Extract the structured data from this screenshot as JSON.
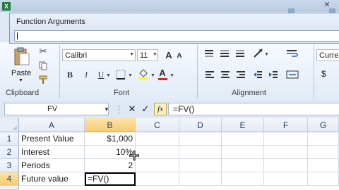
{
  "dialog": {
    "title": "Function Arguments",
    "input_value": ""
  },
  "ribbon": {
    "clipboard": {
      "label": "Clipboard",
      "paste_label": "Paste"
    },
    "font": {
      "label": "Font",
      "name": "Calibri",
      "size": "11",
      "bold": "B",
      "italic": "I",
      "underline": "U",
      "grow": "A",
      "shrink": "A"
    },
    "alignment": {
      "label": "Alignment"
    },
    "number": {
      "format": "Curren",
      "currency_symbol": "$"
    }
  },
  "formula_bar": {
    "name_box": "FV",
    "fx_label": "fx",
    "cancel": "✕",
    "enter": "✓",
    "content": "=FV()"
  },
  "grid": {
    "columns": [
      "A",
      "B",
      "C",
      "D",
      "E",
      "F",
      "G"
    ],
    "active_column": "B",
    "active_row": "4",
    "rows": [
      {
        "num": "1",
        "a": "Present Value",
        "b": "$1,000"
      },
      {
        "num": "2",
        "a": "Interest",
        "b": "10%"
      },
      {
        "num": "3",
        "a": "Periods",
        "b": "2"
      },
      {
        "num": "4",
        "a": "Future value",
        "b": "=FV()"
      }
    ]
  },
  "colors": {
    "accent": "#f8cb71",
    "ribbon": "#e2ebf7",
    "dialog": "#d5e2f2"
  }
}
